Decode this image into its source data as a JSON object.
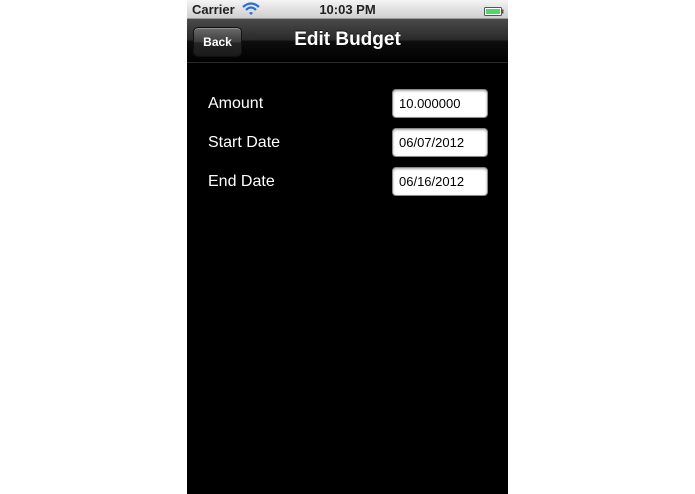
{
  "status_bar": {
    "carrier": "Carrier",
    "time": "10:03 PM",
    "wifi_icon": "wifi-icon",
    "battery_icon": "battery-icon"
  },
  "nav_bar": {
    "back_label": "Back",
    "title": "Edit Budget"
  },
  "form": {
    "amount": {
      "label": "Amount",
      "value": "10.000000"
    },
    "start_date": {
      "label": "Start Date",
      "value": "06/07/2012"
    },
    "end_date": {
      "label": "End Date",
      "value": "06/16/2012"
    }
  },
  "colors": {
    "background": "#000000",
    "text": "#ffffff",
    "battery": "#4cd964"
  }
}
